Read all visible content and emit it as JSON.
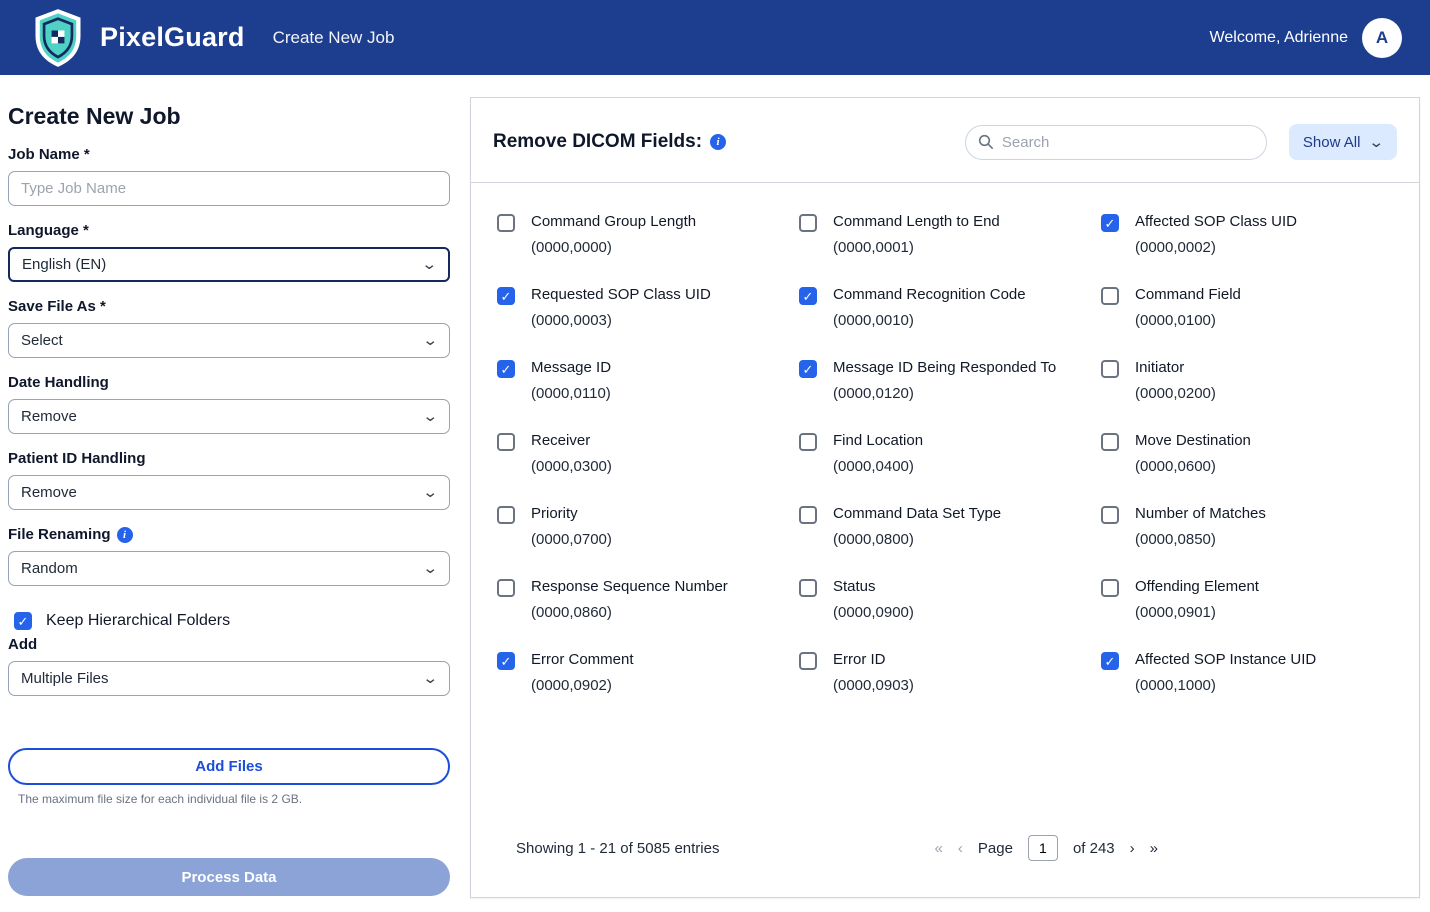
{
  "navbar": {
    "brand": "PixelGuard",
    "nav_item": "Create New Job",
    "welcome": "Welcome, Adrienne",
    "avatar_initial": "A"
  },
  "form": {
    "title": "Create New Job",
    "job_name": {
      "label": "Job Name *",
      "placeholder": "Type Job Name"
    },
    "language": {
      "label": "Language *",
      "value": "English (EN)"
    },
    "save_file_as": {
      "label": "Save File As *",
      "value": "Select"
    },
    "date_handling": {
      "label": "Date Handling",
      "value": "Remove"
    },
    "patient_id_handling": {
      "label": "Patient ID Handling",
      "value": "Remove"
    },
    "file_renaming": {
      "label": "File Renaming",
      "value": "Random"
    },
    "keep_hierarchical": {
      "label": "Keep Hierarchical Folders",
      "checked": true
    },
    "add": {
      "label": "Add",
      "value": "Multiple Files"
    },
    "add_files_button": "Add Files",
    "max_file_note": "The maximum file size for each individual file is 2 GB.",
    "process_button": "Process Data"
  },
  "panel": {
    "title": "Remove DICOM Fields:",
    "search_placeholder": "Search",
    "show_all_label": "Show All",
    "fields": [
      {
        "label": "Command Group Length",
        "code": "(0000,0000)",
        "checked": false
      },
      {
        "label": "Command Length to End",
        "code": "(0000,0001)",
        "checked": false
      },
      {
        "label": "Affected SOP Class UID",
        "code": "(0000,0002)",
        "checked": true
      },
      {
        "label": "Requested SOP Class UID",
        "code": "(0000,0003)",
        "checked": true
      },
      {
        "label": "Command Recognition Code",
        "code": "(0000,0010)",
        "checked": true
      },
      {
        "label": "Command Field",
        "code": "(0000,0100)",
        "checked": false
      },
      {
        "label": "Message ID",
        "code": "(0000,0110)",
        "checked": true
      },
      {
        "label": "Message ID Being Responded To",
        "code": "(0000,0120)",
        "checked": true
      },
      {
        "label": "Initiator",
        "code": "(0000,0200)",
        "checked": false
      },
      {
        "label": "Receiver",
        "code": "(0000,0300)",
        "checked": false
      },
      {
        "label": "Find Location",
        "code": "(0000,0400)",
        "checked": false
      },
      {
        "label": "Move Destination",
        "code": "(0000,0600)",
        "checked": false
      },
      {
        "label": "Priority",
        "code": "(0000,0700)",
        "checked": false
      },
      {
        "label": "Command Data Set Type",
        "code": "(0000,0800)",
        "checked": false
      },
      {
        "label": "Number of Matches",
        "code": "(0000,0850)",
        "checked": false
      },
      {
        "label": "Response Sequence Number",
        "code": "(0000,0860)",
        "checked": false
      },
      {
        "label": "Status",
        "code": "(0000,0900)",
        "checked": false
      },
      {
        "label": "Offending Element",
        "code": "(0000,0901)",
        "checked": false
      },
      {
        "label": "Error Comment",
        "code": "(0000,0902)",
        "checked": true
      },
      {
        "label": "Error ID",
        "code": "(0000,0903)",
        "checked": false
      },
      {
        "label": "Affected SOP Instance UID",
        "code": "(0000,1000)",
        "checked": true
      }
    ],
    "footer": {
      "showing": "Showing 1 - 21 of 5085 entries",
      "first": "«",
      "prev": "‹",
      "page_label": "Page",
      "page_value": "1",
      "of_label": "of 243",
      "next": "›",
      "last": "»"
    }
  },
  "colors": {
    "navbar-bg": "#1d3d8f",
    "accent-blue": "#2563eb",
    "brand-teal": "#4fd1c5",
    "show-all-bg": "#dbeafe",
    "show-all-text": "#1e3a8a",
    "process-btn-bg": "#8ca3d8",
    "add-files-border": "#1d4ed8"
  }
}
